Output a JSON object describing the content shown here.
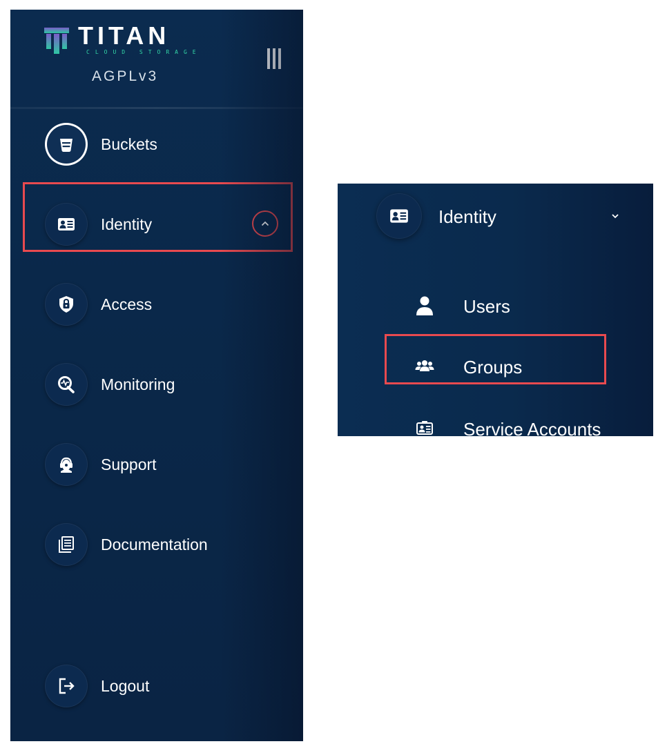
{
  "brand": {
    "name": "TITAN",
    "tagline": "CLOUD STORAGE",
    "license": "AGPLv3"
  },
  "sidebar": {
    "items": [
      {
        "label": "Buckets",
        "icon": "bucket-icon"
      },
      {
        "label": "Identity",
        "icon": "identity-card-icon"
      },
      {
        "label": "Access",
        "icon": "lock-shield-icon"
      },
      {
        "label": "Monitoring",
        "icon": "monitoring-icon"
      },
      {
        "label": "Support",
        "icon": "support-icon"
      },
      {
        "label": "Documentation",
        "icon": "documentation-icon"
      },
      {
        "label": "Logout",
        "icon": "logout-icon"
      }
    ]
  },
  "identity_submenu": {
    "label": "Identity",
    "items": [
      {
        "label": "Users",
        "icon": "user-icon"
      },
      {
        "label": "Groups",
        "icon": "groups-icon"
      },
      {
        "label": "Service Accounts",
        "icon": "service-accounts-icon"
      }
    ]
  },
  "colors": {
    "sidebar_bg": "#0a2748",
    "highlight": "#e84a4f",
    "brand_accent": "#33d6a6",
    "text": "#ffffff"
  }
}
